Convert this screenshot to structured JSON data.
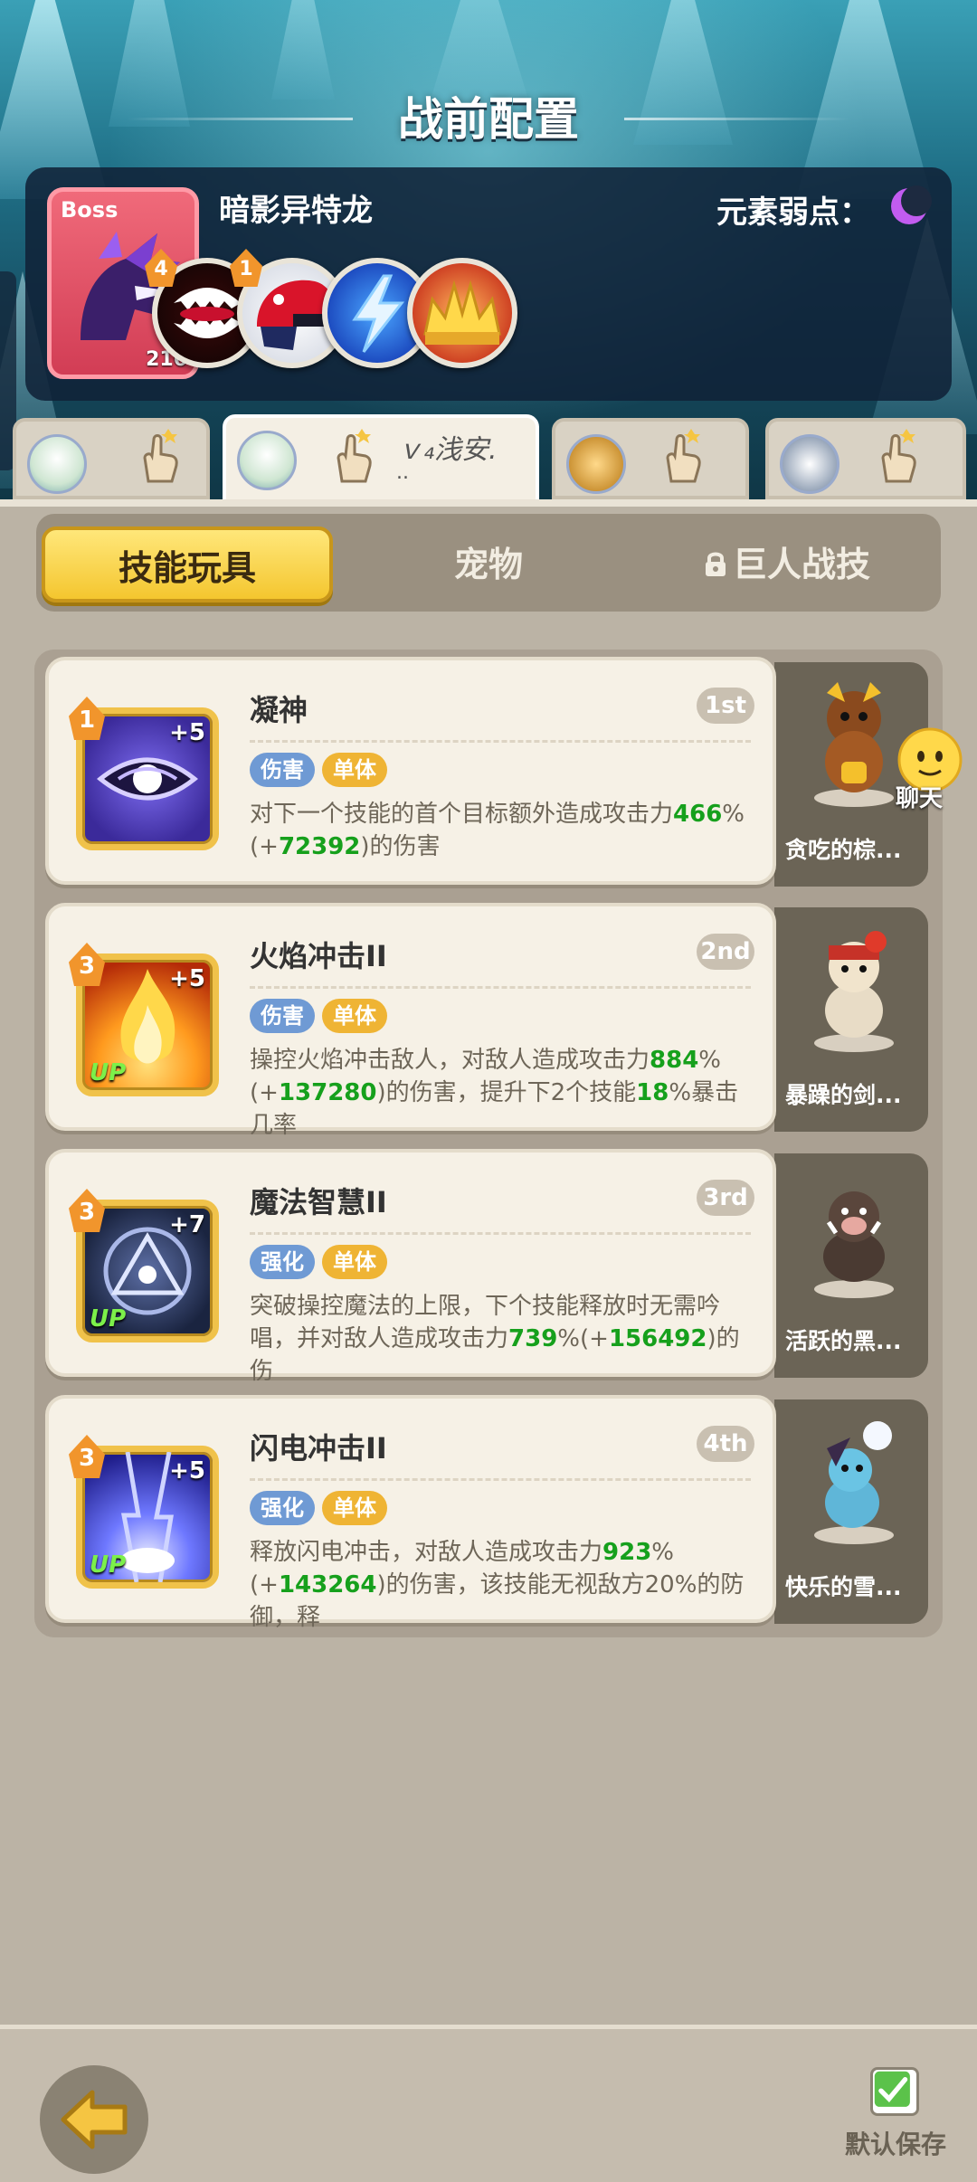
{
  "header": {
    "title": "战前配置",
    "boss": {
      "tag": "Boss",
      "name": "暗影异特龙",
      "level": "216",
      "weakness_label": "元素弱点：",
      "weakness_icon": "moon-icon"
    },
    "boss_skills": [
      {
        "icon": "fanged-maw-icon",
        "level": "4"
      },
      {
        "icon": "red-helmet-icon",
        "level": "1"
      },
      {
        "icon": "lightning-icon",
        "level": ""
      },
      {
        "icon": "golden-crown-icon",
        "level": ""
      }
    ]
  },
  "players": [
    {
      "name": "",
      "icon": "pointing-hand-icon"
    },
    {
      "name": "ｖ₄浅安.",
      "dots": "..",
      "icon": "pointing-hand-icon"
    },
    {
      "name": "",
      "icon": "pointing-hand-icon"
    },
    {
      "name": "",
      "icon": "pointing-hand-icon"
    }
  ],
  "tabs": [
    {
      "label": "技能玩具",
      "active": true
    },
    {
      "label": "宠物",
      "active": false
    },
    {
      "label": "巨人战技",
      "active": false,
      "locked": true
    }
  ],
  "skills": [
    {
      "level": "1",
      "plus": "+5",
      "up": "",
      "title": "凝神",
      "rank": "1st",
      "tags": [
        "伤害",
        "单体"
      ],
      "desc": [
        "对下一个技能的首个目标额外造成攻击力",
        "466",
        "%(+",
        "72392",
        ")的伤害"
      ],
      "pet": "贪吃的棕...",
      "colors": [
        "#3b2a9a",
        "#7d6cf0"
      ]
    },
    {
      "level": "3",
      "plus": "+5",
      "up": "UP",
      "title": "火焰冲击II",
      "rank": "2nd",
      "tags": [
        "伤害",
        "单体"
      ],
      "desc": [
        "操控火焰冲击敌人，对敌人造成攻击力",
        "884",
        "%(+",
        "137280",
        ")的伤害，提升下2个技能",
        "18",
        "%暴击几率",
        "..."
      ],
      "pet": "暴躁的剑...",
      "colors": [
        "#b42a08",
        "#ffb21e"
      ]
    },
    {
      "level": "3",
      "plus": "+7",
      "up": "UP",
      "title": "魔法智慧II",
      "rank": "3rd",
      "tags": [
        "强化",
        "单体"
      ],
      "desc": [
        "突破操控魔法的上限，下个技能释放时无需吟唱，并对敌人造成攻击力",
        "739",
        "%(+",
        "156492",
        ")的伤",
        "..."
      ],
      "pet": "活跃的黑...",
      "colors": [
        "#1a2440",
        "#5d6fa6"
      ]
    },
    {
      "level": "3",
      "plus": "+5",
      "up": "UP",
      "title": "闪电冲击II",
      "rank": "4th",
      "tags": [
        "强化",
        "单体"
      ],
      "desc": [
        "释放闪电冲击，对敌人造成攻击力",
        "923",
        "%(+",
        "143264",
        ")的伤害，该技能无视敌方20%的防御，释",
        "..."
      ],
      "pet": "快乐的雪...",
      "colors": [
        "#1f1d8a",
        "#6e78ff"
      ]
    }
  ],
  "chat": {
    "label": "聊天"
  },
  "footer": {
    "save_label": "默认保存",
    "back_icon": "back-arrow-icon"
  }
}
